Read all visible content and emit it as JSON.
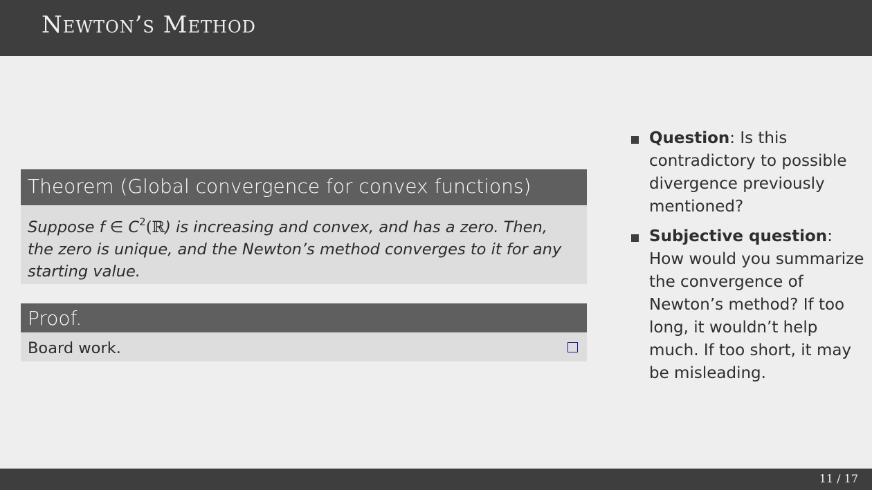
{
  "slide": {
    "title": "Newton’s Method"
  },
  "theorem": {
    "heading": "Theorem (Global convergence for convex functions)",
    "line1_start": "Suppose f ∈ C",
    "line1_exp": "2",
    "line1_paren_open": "(",
    "line1_set": "ℝ",
    "line1_end": ") is increasing and convex, and has a zero. Then,",
    "line2": "the zero is unique, and the Newton’s method converges to it for any",
    "line3": "starting value."
  },
  "proof": {
    "heading": "Proof.",
    "body": "Board work."
  },
  "bullets": [
    {
      "label": "Question",
      "text": ": Is this contradictory to possible divergence previously mentioned?"
    },
    {
      "label": "Subjective question",
      "text": ": How would you summarize the convergence of Newton’s method? If too long, it wouldn’t help much. If too short, it may be misleading."
    }
  ],
  "footer": {
    "page": "11 / 17"
  }
}
